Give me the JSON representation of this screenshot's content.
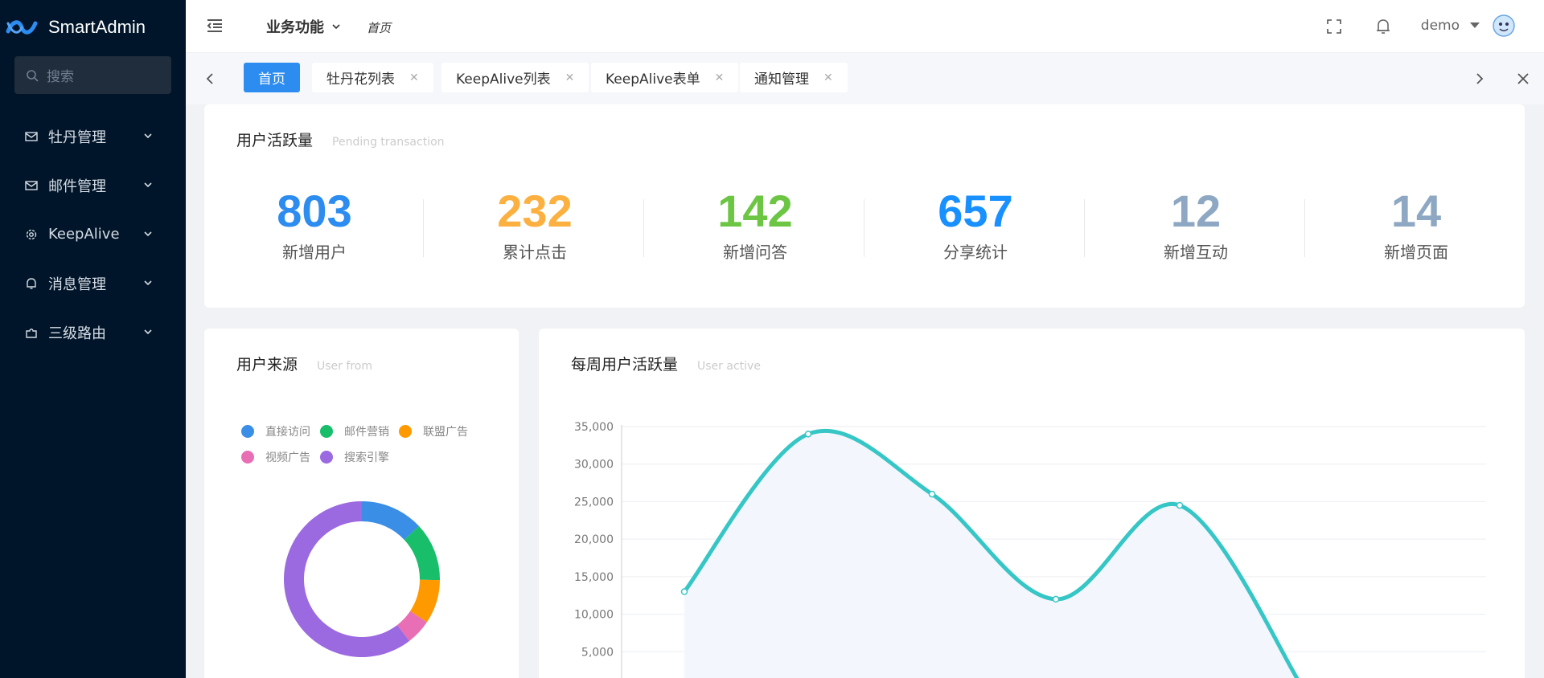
{
  "app": {
    "name": "SmartAdmin"
  },
  "sidebar": {
    "search_placeholder": "搜索",
    "items": [
      {
        "label": "牡丹管理",
        "icon": "mail-icon"
      },
      {
        "label": "邮件管理",
        "icon": "mail-icon"
      },
      {
        "label": "KeepAlive",
        "icon": "gear-icon"
      },
      {
        "label": "消息管理",
        "icon": "bell-icon"
      },
      {
        "label": "三级路由",
        "icon": "puzzle-icon"
      }
    ]
  },
  "header": {
    "menu_label": "业务功能",
    "breadcrumb": "首页",
    "user": "demo"
  },
  "tabs": [
    {
      "label": "首页",
      "active": true
    },
    {
      "label": "牡丹花列表",
      "active": false
    },
    {
      "label": "KeepAlive列表",
      "active": false
    },
    {
      "label": "KeepAlive表单",
      "active": false
    },
    {
      "label": "通知管理",
      "active": false
    }
  ],
  "stats_card": {
    "title": "用户活跃量",
    "subtitle": "Pending transaction",
    "items": [
      {
        "value": "803",
        "label": "新增用户",
        "color": "#2d8cf0"
      },
      {
        "value": "232",
        "label": "累计点击",
        "color": "#fcb040"
      },
      {
        "value": "142",
        "label": "新增问答",
        "color": "#6cc644"
      },
      {
        "value": "657",
        "label": "分享统计",
        "color": "#1890ff"
      },
      {
        "value": "12",
        "label": "新增互动",
        "color": "#8ea8c3"
      },
      {
        "value": "14",
        "label": "新增页面",
        "color": "#8ea8c3"
      }
    ]
  },
  "source_card": {
    "title": "用户来源",
    "subtitle": "User from"
  },
  "weekly_card": {
    "title": "每周用户活跃量",
    "subtitle": "User active"
  },
  "chart_data": [
    {
      "type": "pie",
      "variant": "donut",
      "legend_placement": "top",
      "categories": [
        "直接访问",
        "邮件营销",
        "联盟广告",
        "视频广告",
        "搜索引擎"
      ],
      "values": [
        335,
        310,
        234,
        135,
        1548
      ],
      "colors": [
        "#3a8ee6",
        "#19be6b",
        "#ff9900",
        "#e86eb5",
        "#9b6ae0"
      ]
    },
    {
      "type": "area",
      "smooth": true,
      "y_ticks": [
        "35,000",
        "30,000",
        "25,000",
        "20,000",
        "15,000",
        "10,000",
        "5,000"
      ],
      "ylim": [
        0,
        35000
      ],
      "series": [
        {
          "values": [
            13000,
            34000,
            26000,
            12000,
            24500,
            0
          ],
          "color": "#36c6c6"
        }
      ]
    }
  ]
}
